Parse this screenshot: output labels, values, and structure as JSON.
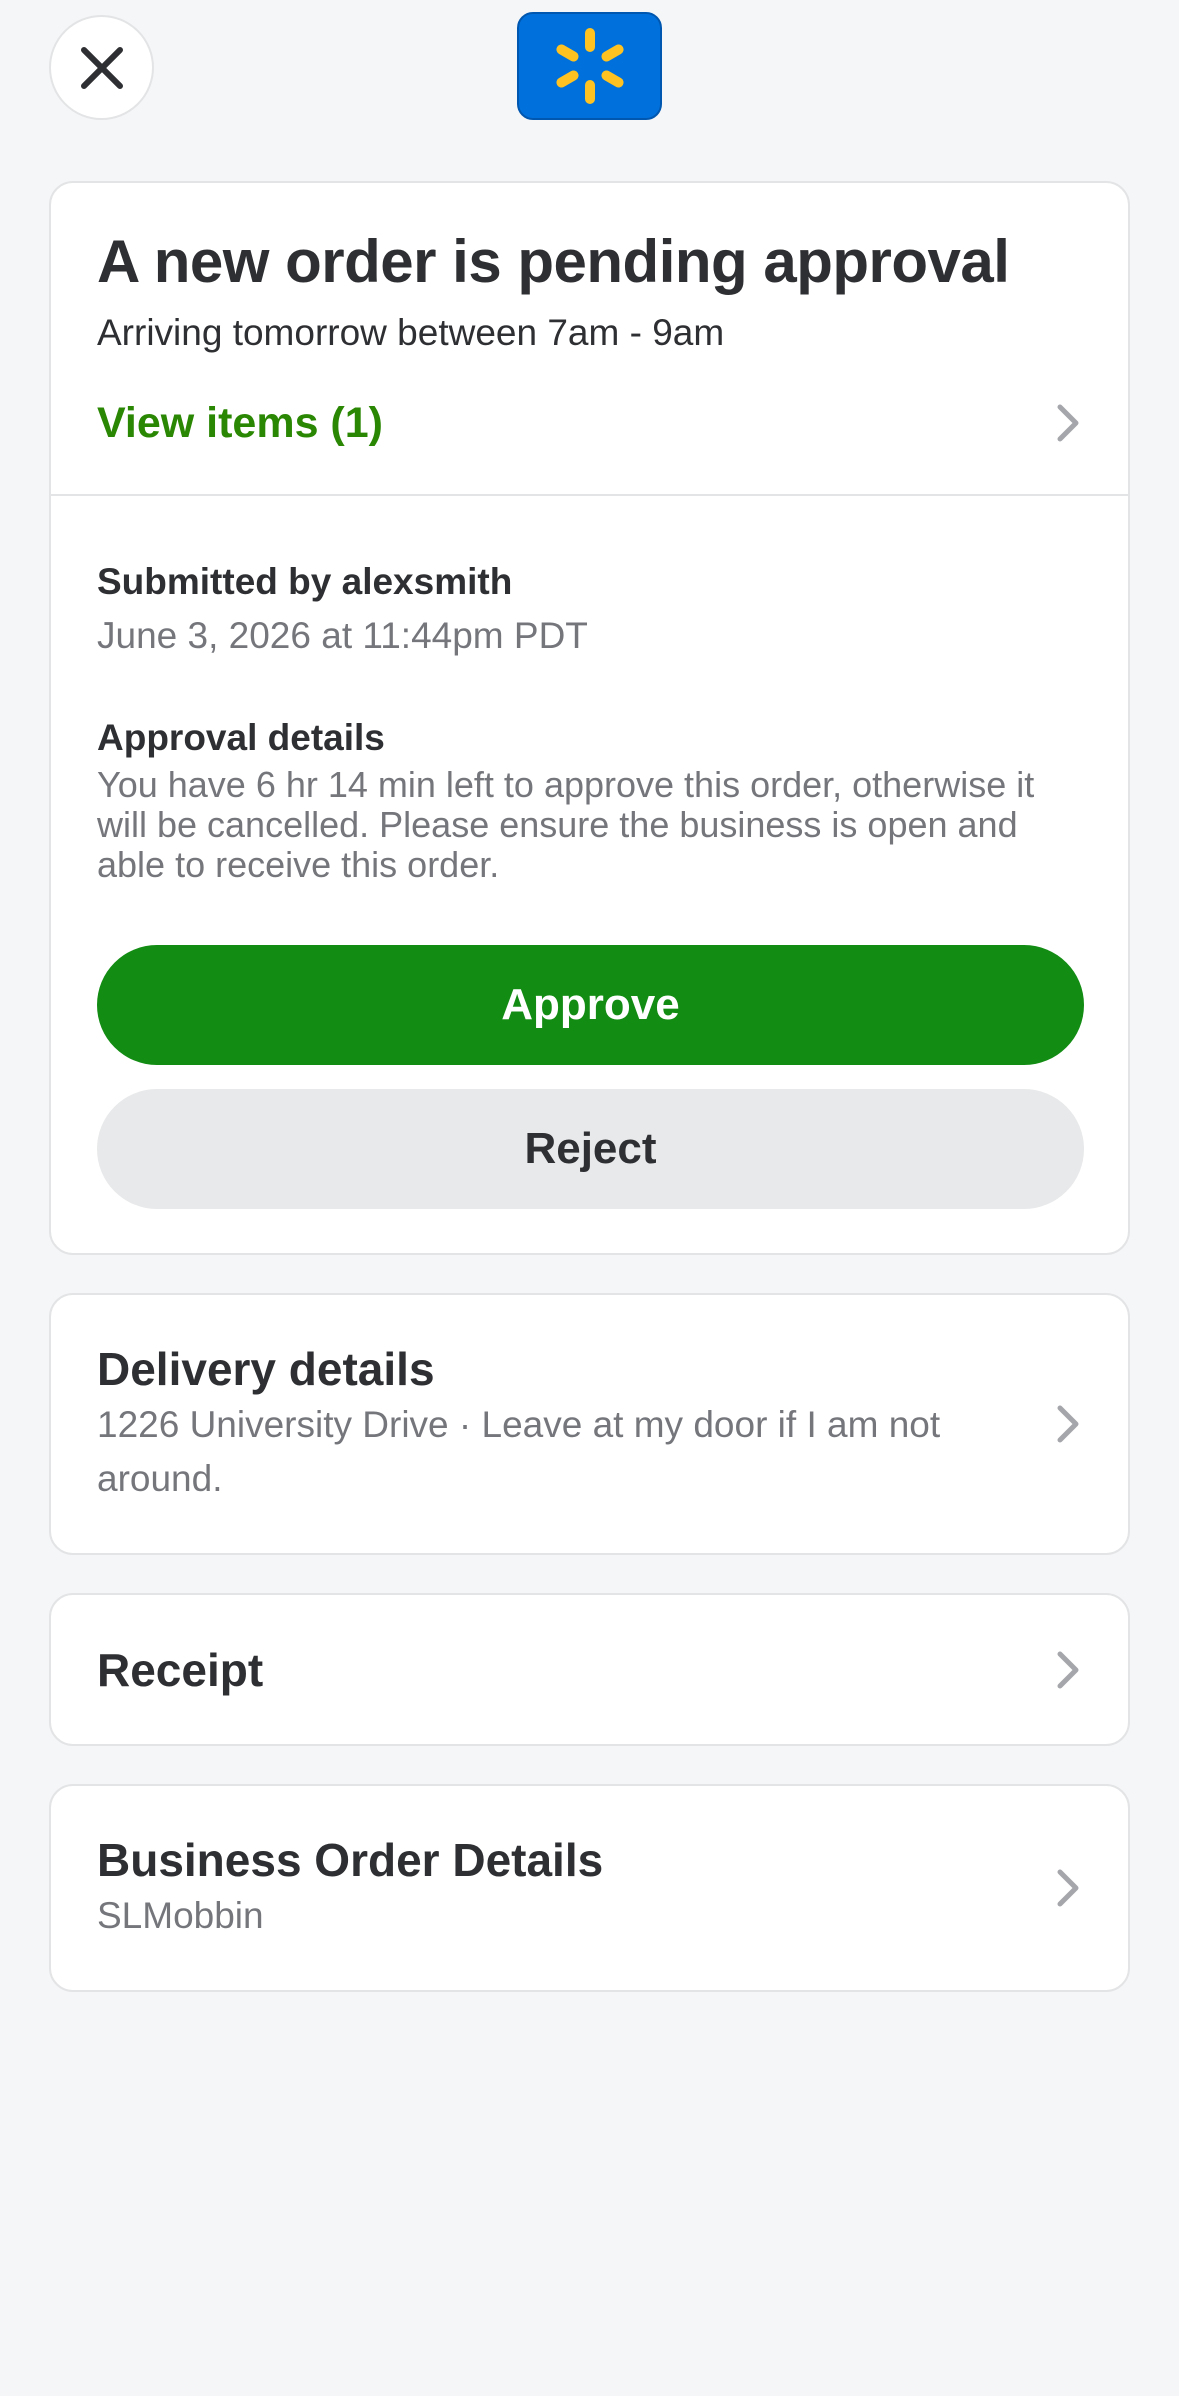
{
  "header": {
    "close_icon": "close-icon",
    "logo_icon": "walmart-spark-icon",
    "brand_color": "#0071dc",
    "spark_color": "#ffc220"
  },
  "order": {
    "title": "A new order is pending approval",
    "subtitle": "Arriving tomorrow between 7am - 9am",
    "view_items_label": "View items (1)",
    "submitted_by": "Submitted by alexsmith",
    "submitted_date": "June 3, 2026 at 11:44pm PDT",
    "approval_heading": "Approval details",
    "approval_text": "You have 6 hr 14 min left to approve this order, otherwise it will be cancelled. Please ensure the business is open and able to receive this order.",
    "approve_label": "Approve",
    "reject_label": "Reject",
    "approve_color": "#128c13",
    "accent_text_color": "#2a8703"
  },
  "delivery": {
    "title": "Delivery details",
    "subtitle": "1226 University Drive · Leave at my door if I am not around."
  },
  "receipt": {
    "title": "Receipt"
  },
  "business": {
    "title": "Business Order Details",
    "subtitle": "SLMobbin"
  }
}
